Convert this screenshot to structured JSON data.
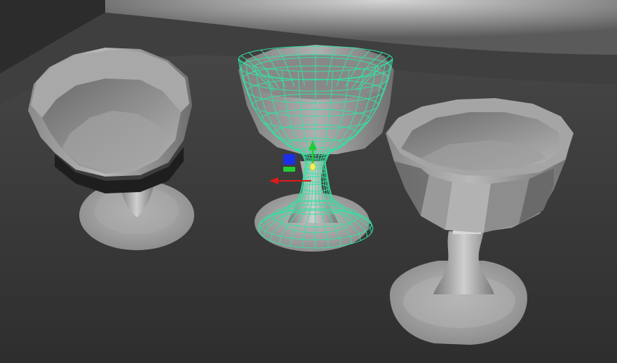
{
  "viewport": {
    "kind": "3d-modeling-viewport",
    "background_color": "#3a3a3a",
    "floor_color": "#454545",
    "backdrop_color": "#9a9a9a"
  },
  "scene_objects": [
    {
      "name": "goblet-left",
      "selected": false,
      "display": "shaded",
      "body_color": "#8f8f8f"
    },
    {
      "name": "goblet-center",
      "selected": true,
      "display": "wireframe-on-shaded",
      "wireframe_color": "#35e0a0"
    },
    {
      "name": "goblet-right",
      "selected": false,
      "display": "shaded",
      "body_color": "#8a8a8a"
    }
  ],
  "manipulator": {
    "tool": "move",
    "axis_colors": {
      "x": "#e01a1a",
      "y": "#22cc33",
      "z": "#1a2fe8",
      "pivot": "#f0f060"
    },
    "icons": [
      "x-axis-arrow-icon",
      "y-axis-arrow-icon",
      "z-axis-handle-icon",
      "pivot-point-icon"
    ]
  }
}
